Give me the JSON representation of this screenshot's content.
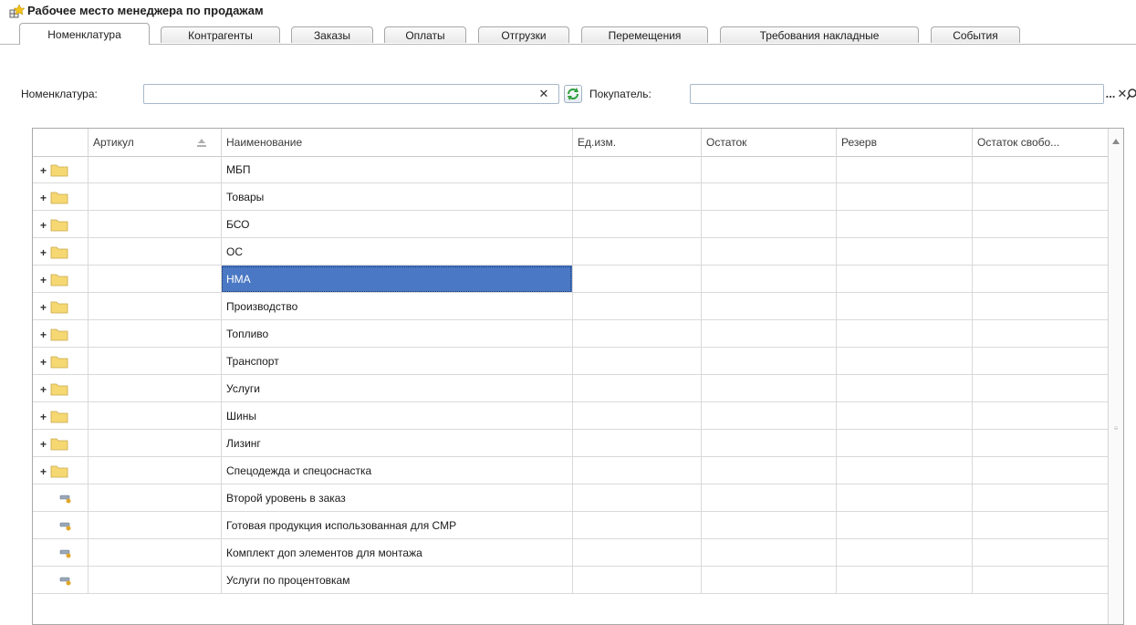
{
  "window": {
    "title": "Рабочее место менеджера по продажам"
  },
  "tabs": [
    {
      "label": "Номенклатура",
      "active": true
    },
    {
      "label": "Контрагенты"
    },
    {
      "label": "Заказы"
    },
    {
      "label": "Оплаты"
    },
    {
      "label": "Отгрузки"
    },
    {
      "label": "Перемещения"
    },
    {
      "label": "Требования накладные"
    },
    {
      "label": "События"
    }
  ],
  "filters": {
    "nomenclature": {
      "label": "Номенклатура:",
      "value": "",
      "placeholder": ""
    },
    "buyer": {
      "label": "Покупатель:",
      "value": "",
      "placeholder": ""
    },
    "clear_icon": "x-icon",
    "refresh_icon": "refresh-icon",
    "select_label": "...",
    "search_icon": "search-icon"
  },
  "table": {
    "columns": [
      "",
      "Артикул",
      "Наименование",
      "Ед.изм.",
      "Остаток",
      "Резерв",
      "Остаток свобо..."
    ],
    "rows": [
      {
        "type": "group",
        "name": "МБП"
      },
      {
        "type": "group",
        "name": "Товары"
      },
      {
        "type": "group",
        "name": "БСО"
      },
      {
        "type": "group",
        "name": "ОС"
      },
      {
        "type": "group",
        "name": "НМА",
        "selected": true
      },
      {
        "type": "group",
        "name": "Производство"
      },
      {
        "type": "group",
        "name": "Топливо"
      },
      {
        "type": "group",
        "name": "Транспорт"
      },
      {
        "type": "group",
        "name": "Услуги"
      },
      {
        "type": "group",
        "name": "Шины"
      },
      {
        "type": "group",
        "name": "Лизинг"
      },
      {
        "type": "group",
        "name": "Спецодежда и спецоснастка"
      },
      {
        "type": "item",
        "name": "Второй уровень в заказ"
      },
      {
        "type": "item",
        "name": "Готовая продукция использованная для СМР"
      },
      {
        "type": "item",
        "name": "Комплект доп элементов для монтажа"
      },
      {
        "type": "item",
        "name": "Услуги по процентовкам"
      }
    ]
  },
  "colors": {
    "selection": "#4a78c4",
    "folder": "#f6d873",
    "refresh": "#2e9e3a"
  }
}
